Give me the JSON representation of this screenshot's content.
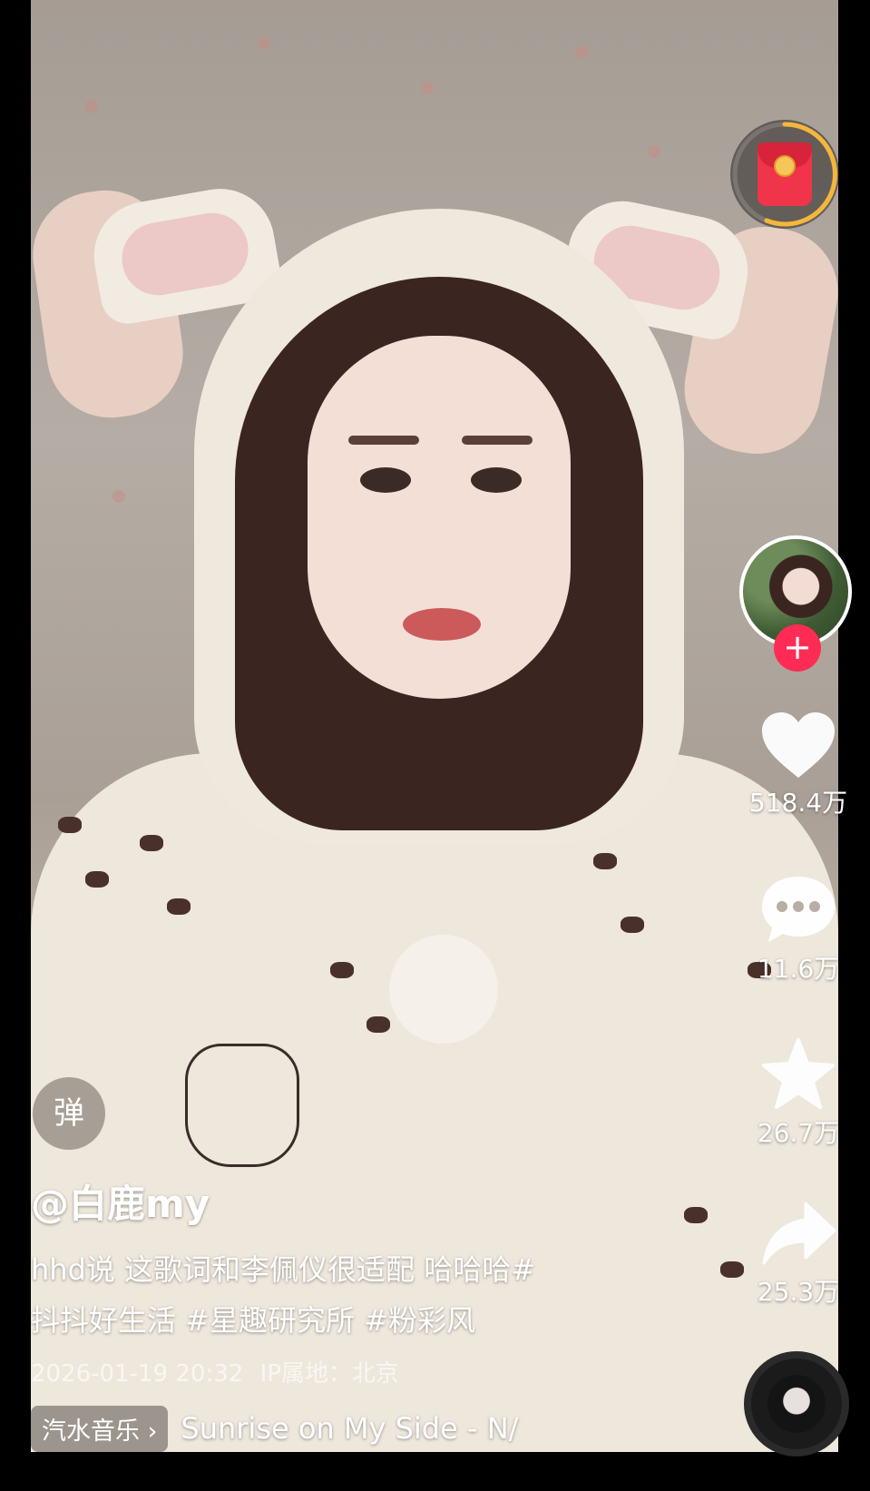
{
  "profile": {
    "author_name": "@白鹿my"
  },
  "post": {
    "caption_line1": "hhd说 这歌词和李佩仪很适配 哈哈哈#",
    "caption_line2": "抖抖好生活 #星趣研究所 #粉彩风",
    "date": "2026-01-19 20:32",
    "ip_location": "IP属地：北京"
  },
  "actions": {
    "like_count": "518.4万",
    "comment_count": "11.6万",
    "favorite_count": "26.7万",
    "share_count": "25.3万"
  },
  "controls": {
    "danmaku_label": "弹",
    "follow_label": "+"
  },
  "music": {
    "app_badge": "汽水音乐 ›",
    "track_title": "Sunrise on My Side - N/"
  },
  "icons": {
    "red_packet": "red-packet-icon",
    "like": "heart-icon",
    "comment": "comment-bubble-icon",
    "favorite": "star-icon",
    "share": "share-arrow-icon",
    "music_disc": "music-disc-icon"
  },
  "colors": {
    "accent_red": "#fe2c55",
    "packet_red": "#f0344a",
    "ring_gold": "#f5b73b"
  }
}
